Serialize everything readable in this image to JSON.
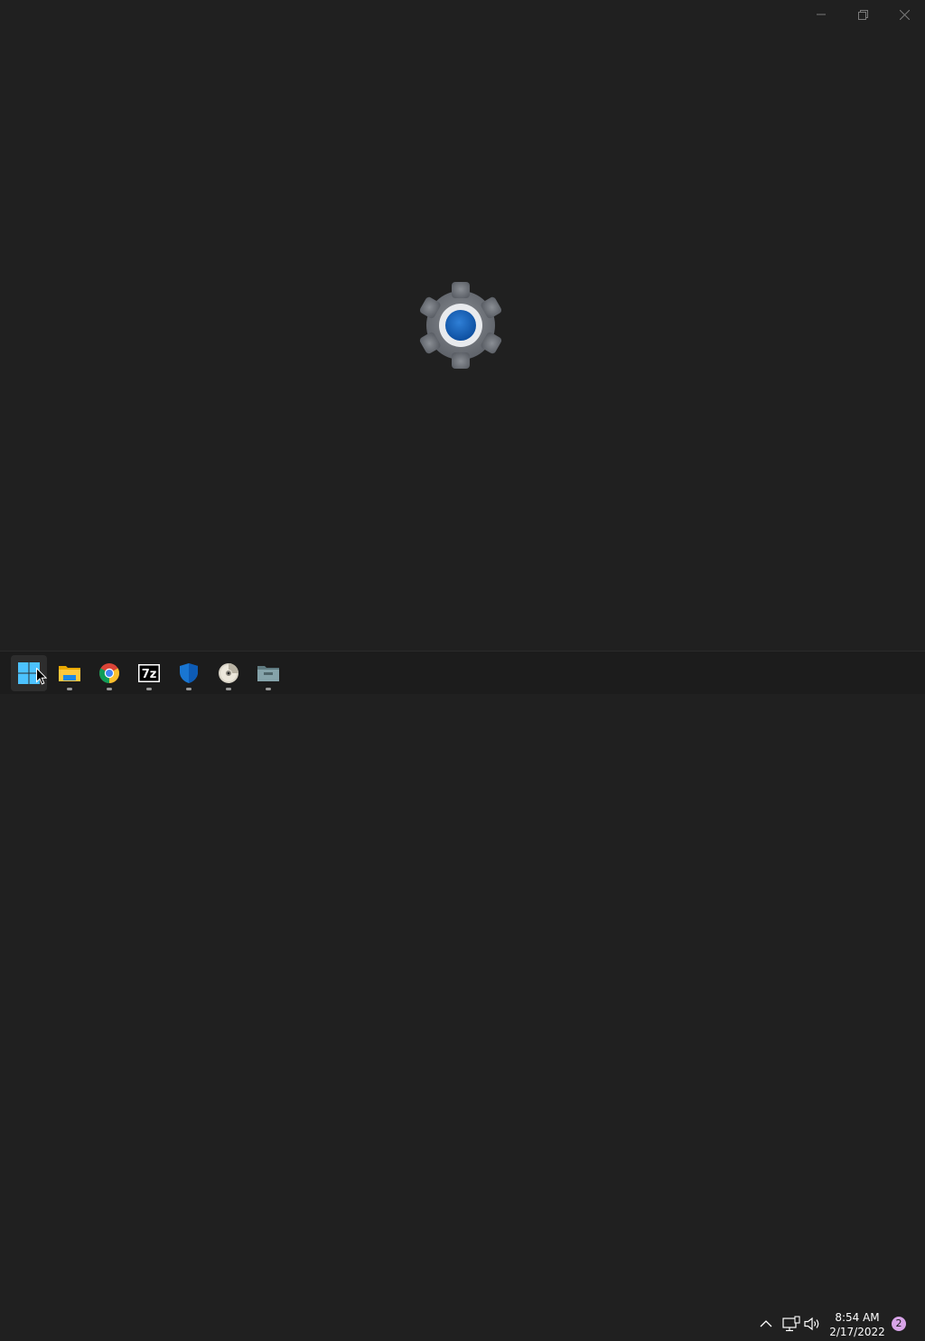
{
  "window": {
    "caption_buttons": [
      {
        "name": "minimize",
        "icon": "minimize-icon"
      },
      {
        "name": "restore",
        "icon": "restore-icon"
      },
      {
        "name": "close",
        "icon": "close-icon"
      }
    ],
    "splash_icon": "settings-gear-icon",
    "background_color": "#202020",
    "gear_accent_color": "#1565c0"
  },
  "taskbar": {
    "background_color": "#1c1c1c",
    "apps": [
      {
        "name": "Start",
        "icon": "windows-start-icon",
        "active": true
      },
      {
        "name": "File Explorer",
        "icon": "file-explorer-icon",
        "running": true
      },
      {
        "name": "Google Chrome",
        "icon": "chrome-icon",
        "running": true
      },
      {
        "name": "7-Zip",
        "icon": "7zip-icon",
        "running": true,
        "text": "7z"
      },
      {
        "name": "Windows Security",
        "icon": "shield-icon",
        "running": true
      },
      {
        "name": "Disc",
        "icon": "disc-icon",
        "running": true
      },
      {
        "name": "Folder",
        "icon": "folder-icon",
        "running": true
      }
    ],
    "tray": {
      "icons": [
        "chevron-up-icon",
        "network-icon",
        "volume-icon"
      ],
      "time": "8:54 AM",
      "date": "2/17/2022",
      "notification_count": "2",
      "notification_color": "#d8a4e8"
    }
  }
}
